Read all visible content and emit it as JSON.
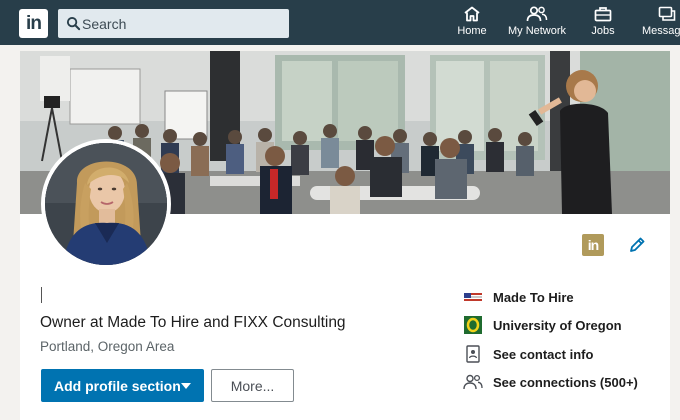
{
  "nav": {
    "logo_text": "in",
    "search_placeholder": "Search",
    "items": [
      {
        "label": "Home",
        "icon": "home-icon"
      },
      {
        "label": "My Network",
        "icon": "network-icon"
      },
      {
        "label": "Jobs",
        "icon": "briefcase-icon"
      },
      {
        "label": "Messag",
        "icon": "messaging-icon"
      }
    ],
    "bg_color": "#283e4a"
  },
  "profile": {
    "badge_text": "in",
    "headline": "Owner at Made To Hire and FIXX Consulting",
    "location": "Portland, Oregon Area",
    "primary_button": "Add profile section",
    "secondary_button": "More...",
    "accent_color": "#0073b1"
  },
  "sidebar": {
    "items": [
      {
        "label": "Made To Hire",
        "icon": "company-logo-icon"
      },
      {
        "label": "University of Oregon",
        "icon": "school-logo-icon"
      },
      {
        "label": "See contact info",
        "icon": "contact-card-icon"
      },
      {
        "label": "See connections (500+)",
        "icon": "people-icon"
      }
    ]
  }
}
